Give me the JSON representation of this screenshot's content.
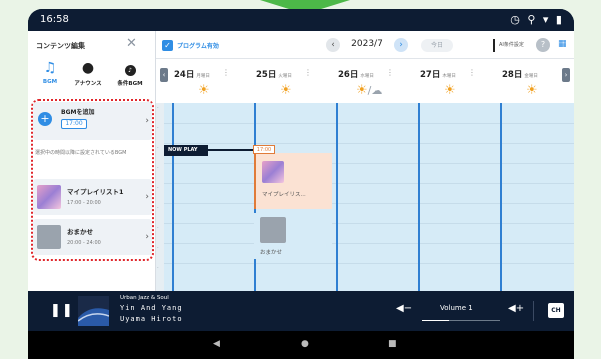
{
  "status": {
    "time": "16:58",
    "icons": "◷ ⚲ ▾ ▮"
  },
  "left_panel": {
    "title": "コンテンツ編集",
    "tabs": [
      {
        "label": "BGM",
        "icon": "music-note-icon",
        "active": true
      },
      {
        "label": "アナウンス",
        "icon": "speech-bubble-icon",
        "active": false
      },
      {
        "label": "条件BGM",
        "icon": "conditional-bgm-icon",
        "active": false
      }
    ],
    "add_bgm": {
      "label": "BGMを追加",
      "time": "17:00"
    },
    "note": "選択中の時間以降に設定されているBGM",
    "items": [
      {
        "name": "マイプレイリスト1",
        "time": "17:00 - 20:00"
      },
      {
        "name": "おまかせ",
        "time": "20:00 - 24:00"
      }
    ]
  },
  "toolbar": {
    "program_toggle_label": "プログラム有効",
    "month": "2023/7",
    "today": "今日",
    "settings_label": "AI条件設定"
  },
  "days": [
    {
      "date": "24日",
      "dow": "月曜日",
      "weather": "sunny"
    },
    {
      "date": "25日",
      "dow": "火曜日",
      "weather": "sunny"
    },
    {
      "date": "26日",
      "dow": "水曜日",
      "weather": "sunny-cloudy"
    },
    {
      "date": "27日",
      "dow": "木曜日",
      "weather": "sunny"
    },
    {
      "date": "28日",
      "dow": "金曜日",
      "weather": "sunny"
    }
  ],
  "timeline": {
    "now_play_label": "NOW PLAY",
    "now_time": "17:00",
    "events": [
      {
        "name": "マイプレイリス..."
      },
      {
        "name": "おまかせ"
      }
    ]
  },
  "player": {
    "genre": "Urban Jazz & Soul",
    "title": "Yin And Yang",
    "artist": "Uyama Hiroto",
    "volume_label": "Volume 1",
    "volume_level": 0.35,
    "cast_label": "CH"
  },
  "colors": {
    "accent": "#2f8de4",
    "dark": "#0d1c33",
    "highlight_border": "#e0262b",
    "event_fill": "#fbe2d3"
  }
}
